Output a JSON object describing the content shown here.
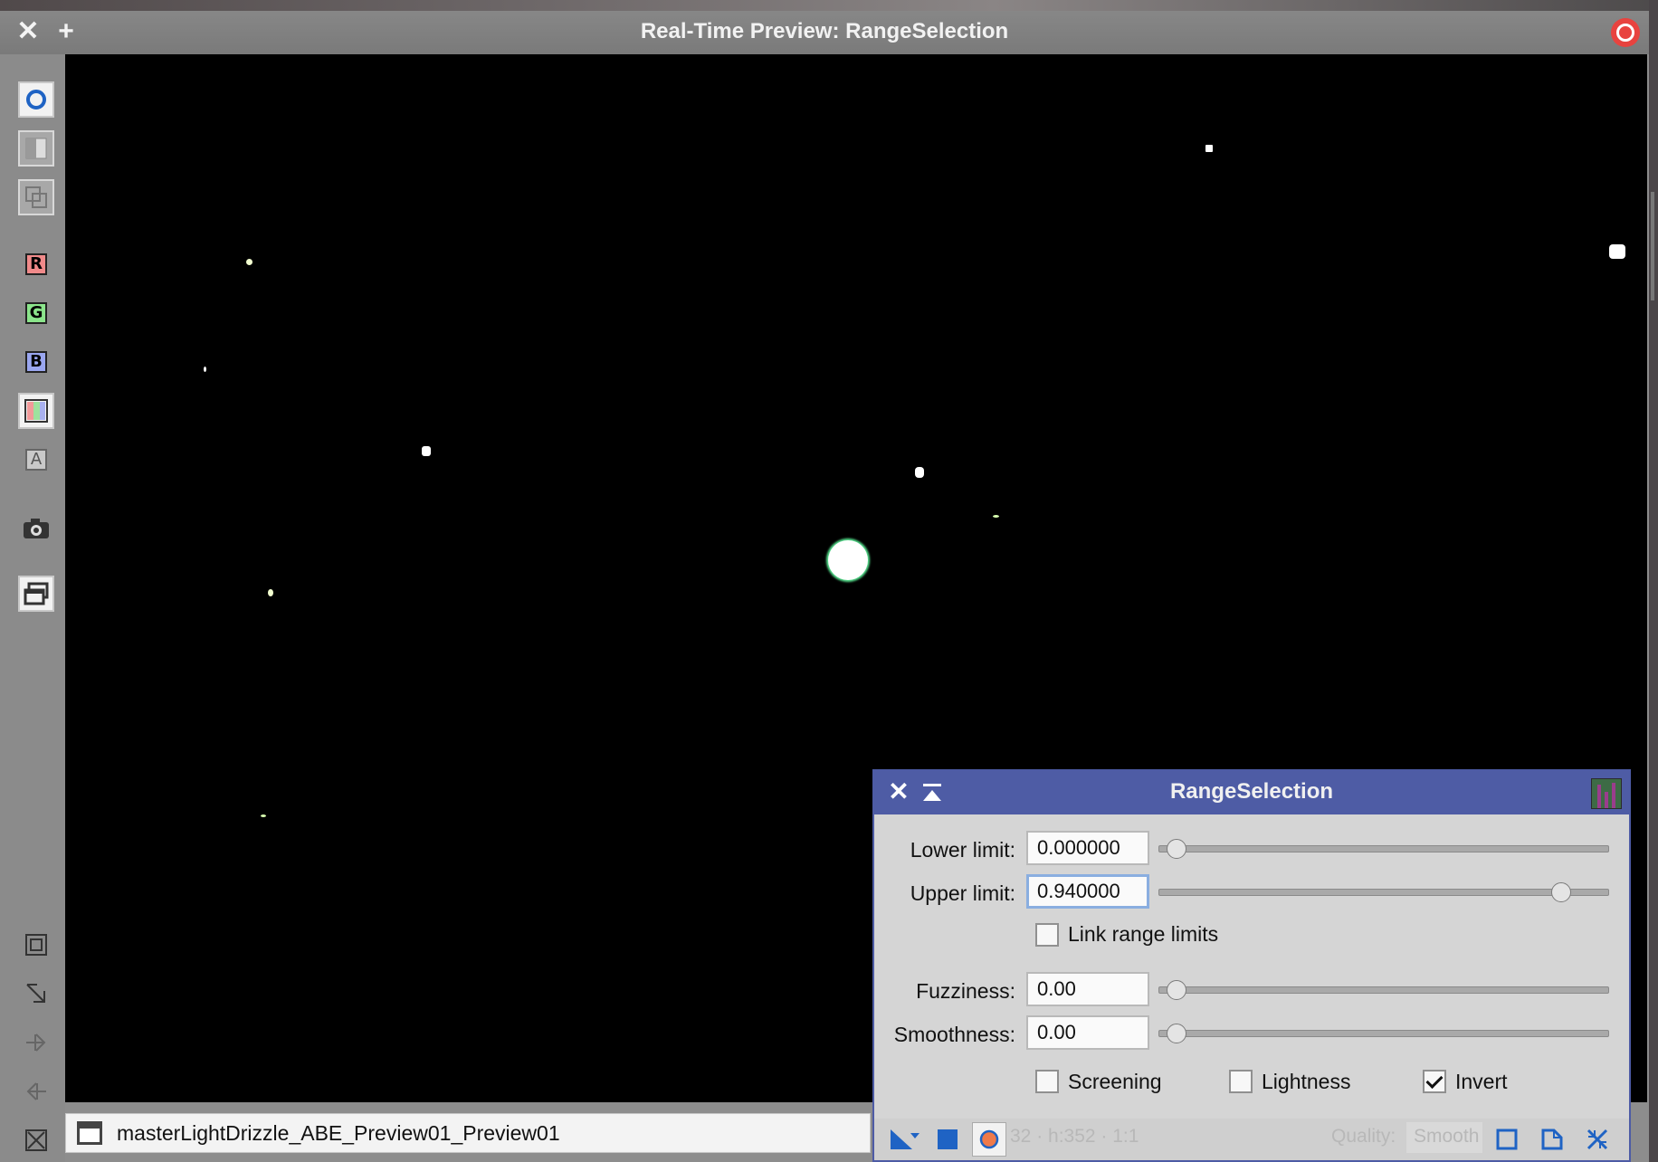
{
  "window": {
    "title": "Real-Time Preview: RangeSelection",
    "close_glyph": "✕",
    "add_glyph": "+"
  },
  "toolbar": {
    "channels": {
      "red": "R",
      "green": "G",
      "blue": "B",
      "alpha": "A"
    }
  },
  "status": {
    "view_name": "masterLightDrizzle_ABE_Preview01_Preview01"
  },
  "dialog": {
    "title": "RangeSelection",
    "close_glyph": "✕",
    "lower_limit": {
      "label": "Lower limit:",
      "value": "0.000000",
      "fraction": 0.0
    },
    "upper_limit": {
      "label": "Upper limit:",
      "value": "0.940000",
      "fraction": 0.94
    },
    "link_range_limits": {
      "label": "Link range limits",
      "checked": false
    },
    "fuzziness": {
      "label": "Fuzziness:",
      "value": "0.00",
      "fraction": 0.0
    },
    "smoothness": {
      "label": "Smoothness:",
      "value": "0.00",
      "fraction": 0.0
    },
    "screening": {
      "label": "Screening",
      "checked": false
    },
    "lightness": {
      "label": "Lightness",
      "checked": false
    },
    "invert": {
      "label": "Invert",
      "checked": true
    },
    "footer": {
      "geometry_ghost": "32 · h:352 · 1:1",
      "quality_label": "Quality:",
      "quality_value": "Smooth"
    }
  },
  "colors": {
    "dialog_titlebar": "#4e5ca5",
    "icon_blue": "#1f63c4",
    "record_red": "#e8433f"
  }
}
